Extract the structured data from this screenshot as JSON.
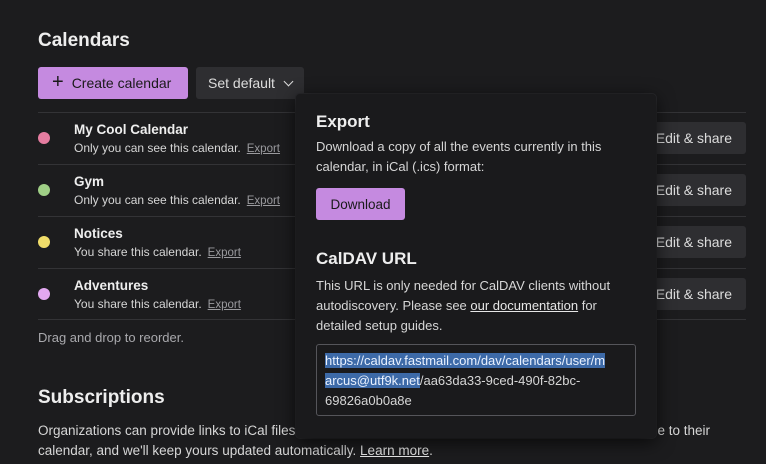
{
  "calendars": {
    "title": "Calendars",
    "create_label": "Create calendar",
    "set_default_label": "Set default",
    "items": [
      {
        "name": "My Cool Calendar",
        "description": "Only you can see this calendar.",
        "export_label": "Export",
        "edit_label": "Edit & share",
        "color": "#e57ca0"
      },
      {
        "name": "Gym",
        "description": "Only you can see this calendar.",
        "export_label": "Export",
        "edit_label": "Edit & share",
        "color": "#9fcf86"
      },
      {
        "name": "Notices",
        "description": "You share this calendar.",
        "export_label": "Export",
        "edit_label": "Edit & share",
        "color": "#f0dd6a"
      },
      {
        "name": "Adventures",
        "description": "You share this calendar.",
        "export_label": "Export",
        "edit_label": "Edit & share",
        "color": "#e2a8f0"
      }
    ],
    "hint": "Drag and drop to reorder."
  },
  "subscriptions": {
    "title": "Subscriptions",
    "text_line1_left": "Organizations can provide links to iCal files",
    "text_line1_right": "be to their",
    "text_line2": "calendar, and we'll keep yours updated automatically.",
    "learn_more": "Learn more",
    "period": "."
  },
  "popover": {
    "export_title": "Export",
    "export_desc_line1": "Download a copy of all the events currently in this",
    "export_desc_line2": "calendar, in iCal (.ics) format:",
    "download_label": "Download",
    "caldav_title": "CalDAV URL",
    "caldav_desc_line1": "This URL is only needed for CalDAV clients without",
    "caldav_desc_line2_pre": "autodiscovery. Please see ",
    "caldav_doc_link": "our documentation",
    "caldav_desc_line2_post": " for",
    "caldav_desc_line3": "detailed setup guides.",
    "url_line1": "https://caldav.fastmail.com/dav/calendars/user/m",
    "url_line2_selected": "arcus@utf9k.net",
    "url_line2_rest": "/aa63da33-9ced-490f-82bc-",
    "url_line3": "69826a0b0a8e"
  },
  "colors": {
    "accent": "#c58ae0",
    "background": "#1c1c1e",
    "selection": "#3d6aa8"
  },
  "icons": {
    "create": "plus-icon",
    "set_default": "chevron-down-icon"
  }
}
